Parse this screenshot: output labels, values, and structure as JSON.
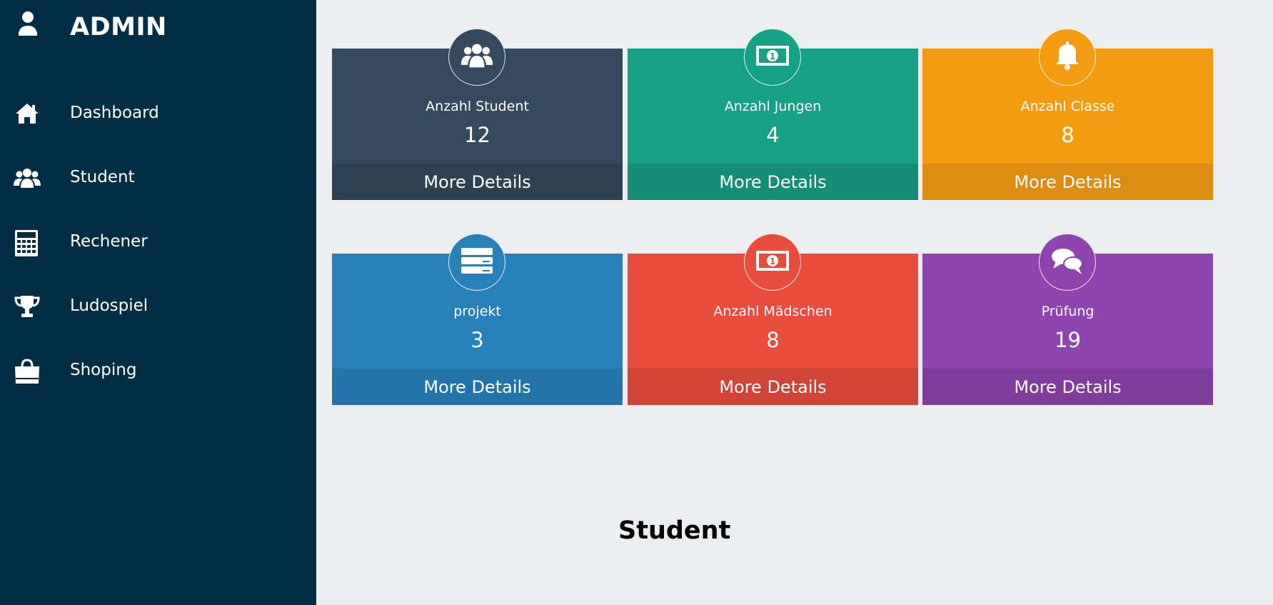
{
  "sidebar": {
    "brand": {
      "title": "ADMIN",
      "icon": "user-icon"
    },
    "items": [
      {
        "label": "Dashboard",
        "icon": "home-icon"
      },
      {
        "label": "Student",
        "icon": "users-icon"
      },
      {
        "label": "Rechener",
        "icon": "calculator-icon"
      },
      {
        "label": "Ludospiel",
        "icon": "trophy-icon"
      },
      {
        "label": "Shoping",
        "icon": "shopping-bag-icon"
      }
    ]
  },
  "cards": [
    {
      "label": "Anzahl Student",
      "value": "12",
      "footer": "More Details",
      "icon": "users-icon",
      "color": "#34495e",
      "footer_color": "#2e4152"
    },
    {
      "label": "Anzahl Jungen",
      "value": "4",
      "footer": "More Details",
      "icon": "money-icon",
      "color": "#16a085",
      "footer_color": "#138d75"
    },
    {
      "label": "Anzahl Classe",
      "value": "8",
      "footer": "More Details",
      "icon": "bell-icon",
      "color": "#f39c12",
      "footer_color": "#dc8c10"
    },
    {
      "label": "projekt",
      "value": "3",
      "footer": "More Details",
      "icon": "server-icon",
      "color": "#2980b9",
      "footer_color": "#2574a9"
    },
    {
      "label": "Anzahl Mädschen",
      "value": "8",
      "footer": "More Details",
      "icon": "money-icon",
      "color": "#e74c3c",
      "footer_color": "#d04436"
    },
    {
      "label": "Prüfung",
      "value": "19",
      "footer": "More Details",
      "icon": "comments-icon",
      "color": "#8e44ad",
      "footer_color": "#7f3d9c"
    }
  ],
  "main": {
    "section_title": "Student"
  }
}
